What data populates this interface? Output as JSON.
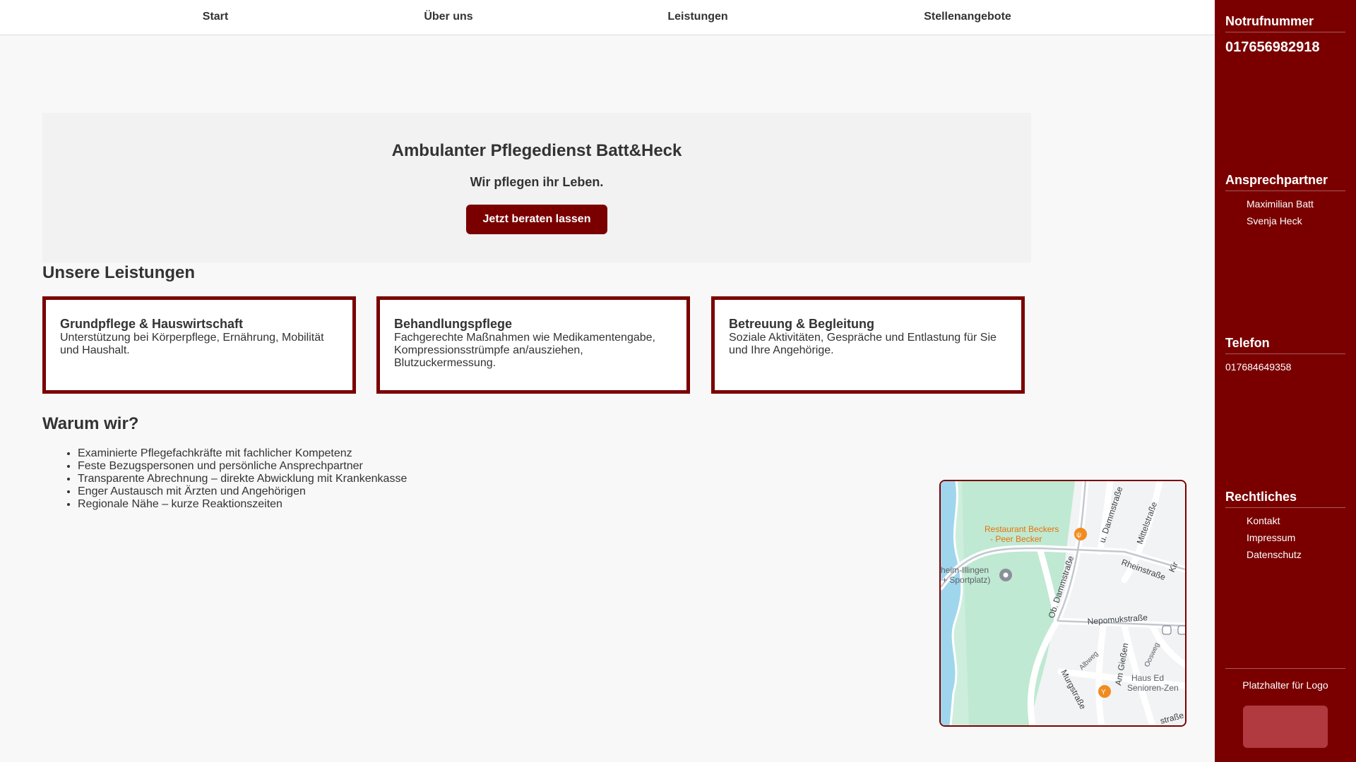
{
  "nav": {
    "items": [
      "Start",
      "Über uns",
      "Leistungen",
      "Stellenangebote"
    ]
  },
  "hero": {
    "title": "Ambulanter Pflegedienst Batt&Heck",
    "subtitle": "Wir pflegen ihr Leben.",
    "cta_label": "Jetzt beraten lassen"
  },
  "services": {
    "heading": "Unsere Leistungen",
    "cards": [
      {
        "title": "Grundpflege & Hauswirtschaft",
        "desc": "Unterstützung bei Körperpflege, Ernährung, Mobilität und Haushalt."
      },
      {
        "title": "Behandlungspflege",
        "desc": "Fachgerechte Maßnahmen wie Medikamentengabe, Kompressionsstrümpfe an/ausziehen, Blutzuckermessung."
      },
      {
        "title": "Betreuung & Begleitung",
        "desc": "Soziale Aktivitäten, Gespräche und Entlastung für Sie und Ihre Angehörige."
      }
    ]
  },
  "why": {
    "heading": "Warum wir?",
    "items": [
      "Examinierte Pflegefachkräfte mit fachlicher Kompetenz",
      "Feste Bezugspersonen und persönliche Ansprechpartner",
      "Transparente Abrechnung – direkte Abwicklung mit Krankenkasse",
      "Enger Austausch mit Ärzten und Angehörigen",
      "Regionale Nähe – kurze Reaktionszeiten"
    ]
  },
  "map": {
    "labels": {
      "restaurant": "Restaurant Beckers",
      "restaurant2": "- Peer Becker",
      "place": "heim-Illingen",
      "place2": "+ Sportplatz)",
      "street1": "u. Dammstraße",
      "street2": "Mittelstraße",
      "street3": "Rheinstraße",
      "street4": "Ob. Dammstraße",
      "street5": "Nepomukstraße",
      "street6": "Am Gießen",
      "street7": "Albweg",
      "street8": "Oosweg",
      "street9": "Murgstraße",
      "home": "Haus Ed",
      "home2": "Senioren-Zen",
      "street10": "straße",
      "street11": "Kir"
    }
  },
  "sidebar": {
    "emergency_heading": "Notrufnummer",
    "emergency_number": "017656982918",
    "contact_heading": "Ansprechpartner",
    "contacts": [
      "Maximilian Batt",
      "Svenja Heck"
    ],
    "phone_heading": "Telefon",
    "phone": "017684649358",
    "legal_heading": "Rechtliches",
    "legal_links": [
      "Kontakt",
      "Impressum",
      "Datenschutz"
    ],
    "logo_placeholder": "Platzhalter für Logo"
  },
  "colors": {
    "brand": "#7a0000",
    "logo_box": "#b03a3f",
    "background": "#f8f8f8"
  }
}
